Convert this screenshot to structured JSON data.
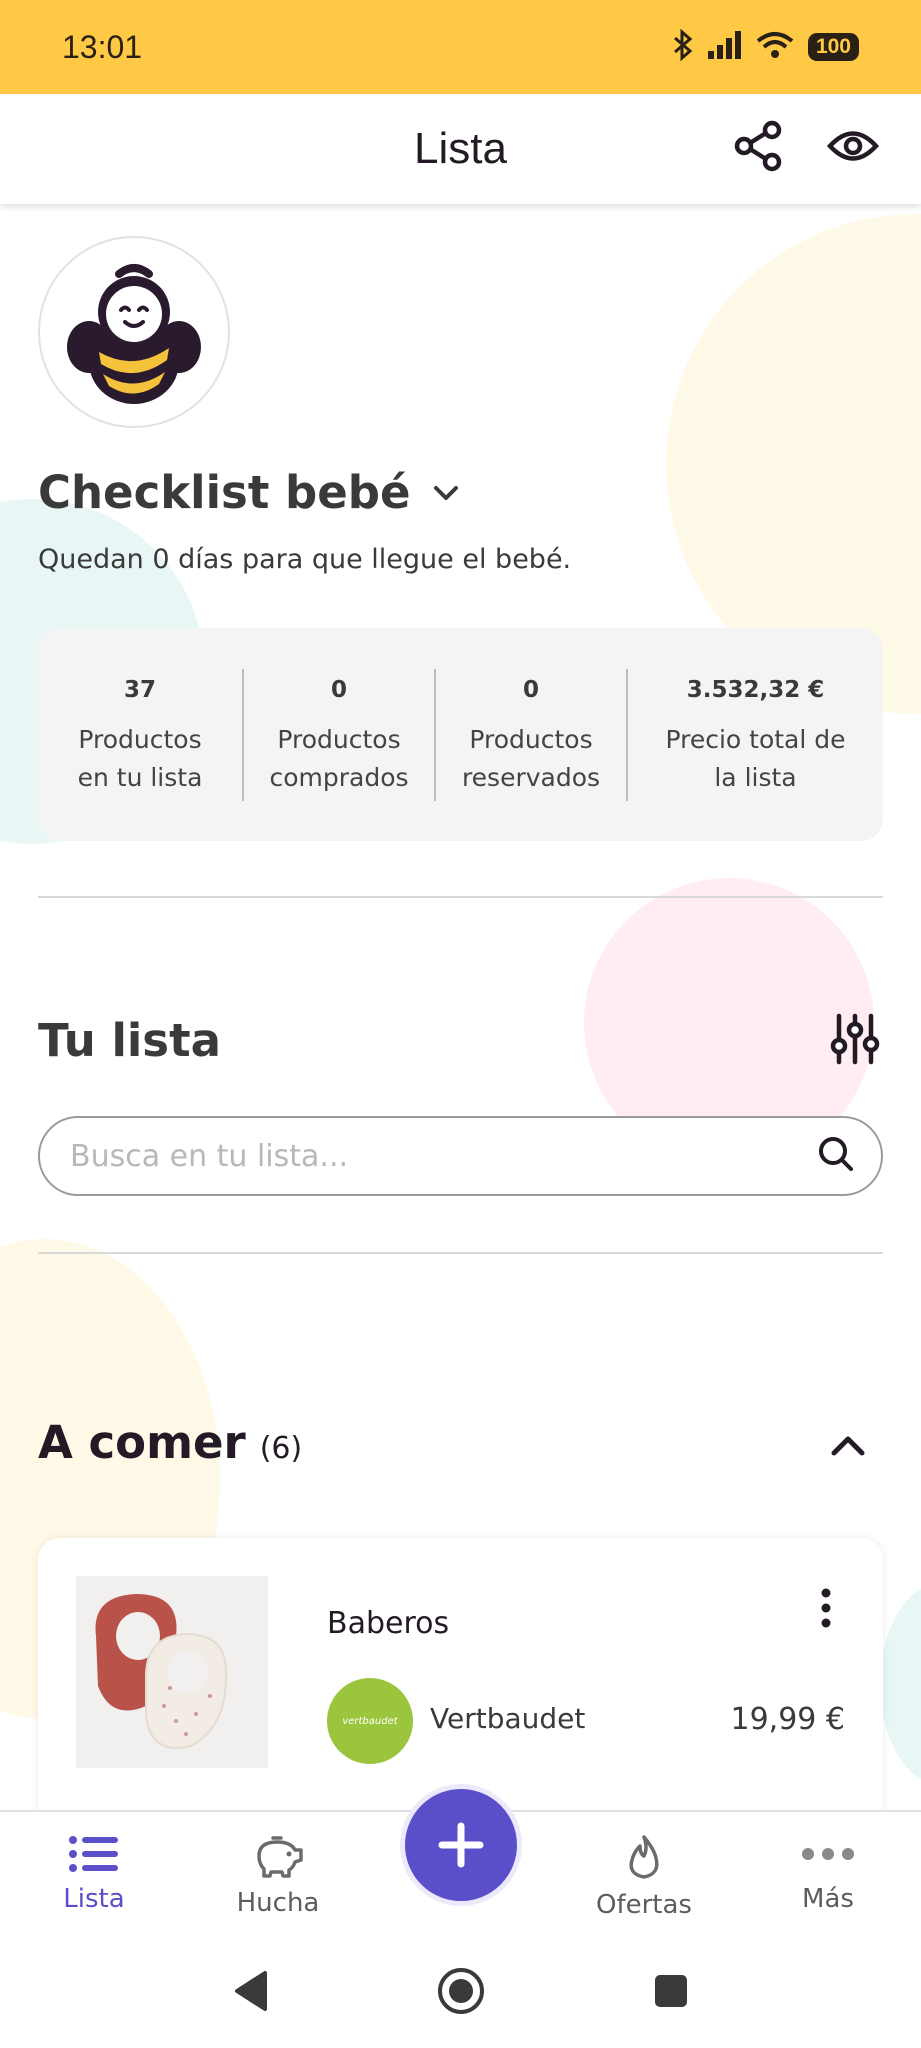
{
  "status_bar": {
    "time": "13:01",
    "battery": "100"
  },
  "header": {
    "title": "Lista"
  },
  "list": {
    "title": "Checklist bebé",
    "subtitle": "Quedan 0 días para que llegue el bebé."
  },
  "stats": [
    {
      "value": "37",
      "label_line1": "Productos",
      "label_line2": "en tu lista"
    },
    {
      "value": "0",
      "label_line1": "Productos",
      "label_line2": "comprados"
    },
    {
      "value": "0",
      "label_line1": "Productos",
      "label_line2": "reservados"
    },
    {
      "value": "3.532,32 €",
      "label_line1": "Precio total de",
      "label_line2": "la lista"
    }
  ],
  "section": {
    "title": "Tu lista"
  },
  "search": {
    "placeholder": "Busca en tu lista..."
  },
  "category": {
    "name": "A comer",
    "count": "(6)"
  },
  "product": {
    "name": "Baberos",
    "store": "Vertbaudet",
    "store_logo_text": "vertbaudet",
    "price": "19,99 €"
  },
  "bottom_nav": [
    {
      "label": "Lista",
      "icon": "list-icon",
      "active": true
    },
    {
      "label": "Hucha",
      "icon": "piggy-bank-icon",
      "active": false
    },
    {
      "label": "Ofertas",
      "icon": "flame-icon",
      "active": false
    },
    {
      "label": "Más",
      "icon": "more-dots-icon",
      "active": false
    }
  ],
  "colors": {
    "status_bar": "#FFC845",
    "accent": "#5B4FC9",
    "card_bg": "#F4F4F4",
    "store_logo": "#9BC53D"
  }
}
